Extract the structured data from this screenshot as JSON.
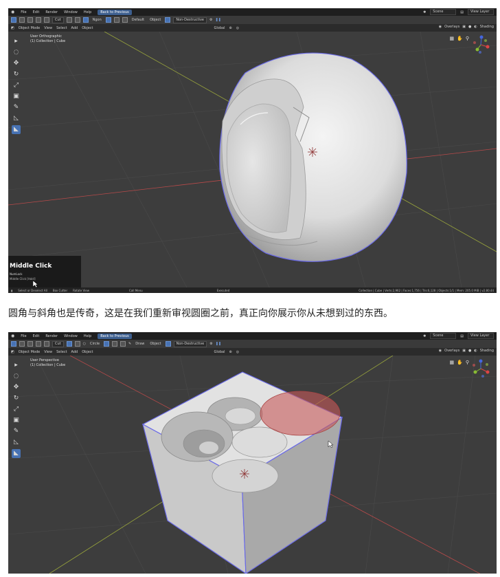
{
  "shot1": {
    "menu": [
      "File",
      "Edit",
      "Render",
      "Window",
      "Help"
    ],
    "back_button": "Back to Previous",
    "scene_label": "Scene",
    "view_layer_label": "View Layer",
    "toolbar": {
      "cut_label": "Cut",
      "ngon_label": "Ngon",
      "default_label": "Default",
      "object_label": "Object",
      "non_destructive_label": "Non-Destructive"
    },
    "header": {
      "mode": "Object Mode",
      "menus": [
        "View",
        "Select",
        "Add",
        "Object"
      ],
      "orientation": "Global",
      "overlays": "Overlays",
      "shading": "Shading"
    },
    "viewport_info": [
      "User Orthographic",
      "(1) Collection | Cube"
    ],
    "operator_panel": {
      "title": "Middle Click",
      "line1": "NumLock",
      "line2": "Middle Click [Hold]"
    },
    "status": {
      "left1": "Select or Deselect All",
      "left2": "Box Cutter",
      "left3": "Rotate View",
      "mid": "Call Menu",
      "executed": "Executed",
      "right": "Collection | Cube | Verts:2,962 | Faces:1,756 | Tris:6,128 | Objects:1/1 | Mem: 205.0 MiB | v2.80.44"
    }
  },
  "caption": "圆角与斜角也是传奇，这是在我们重新审视圆圈之前，真正向你展示你从未想到过的东西。",
  "shot2": {
    "menu": [
      "File",
      "Edit",
      "Render",
      "Window",
      "Help"
    ],
    "back_button": "Back to Previous",
    "scene_label": "Scene",
    "view_layer_label": "View Layer",
    "toolbar": {
      "cut_label": "Cut",
      "circle_label": "Circle",
      "draw_label": "Draw",
      "object_label": "Object",
      "non_destructive_label": "Non-Destructive"
    },
    "header": {
      "mode": "Object Mode",
      "menus": [
        "View",
        "Select",
        "Add",
        "Object"
      ],
      "orientation": "Global",
      "overlays": "Overlays",
      "shading": "Shading"
    },
    "viewport_info": [
      "User Perspective",
      "(1) Collection | Cube"
    ]
  },
  "colors": {
    "accent": "#4772b3",
    "outline": "#6a6ae8",
    "grid_x": "#b84a4a",
    "grid_y": "#9aa63c",
    "circle_fill": "#c85a5a"
  }
}
